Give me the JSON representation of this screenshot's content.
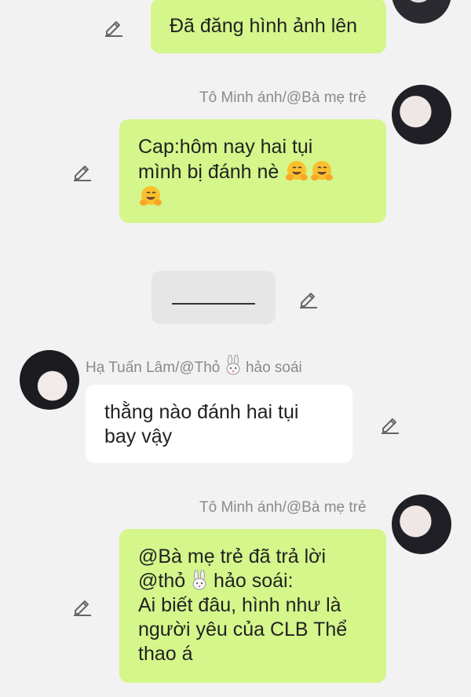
{
  "messages": [
    {
      "text": "Đã đăng hình ảnh lên"
    },
    {
      "sender": "Tô Minh ánh/@Bà mẹ trẻ",
      "text": "Cap:hôm nay hai tụi\nmình bị đánh nè",
      "emoji": "hugging-face"
    },
    {
      "text": ""
    },
    {
      "sender_prefix": "Hạ Tuấn Lâm/@Thỏ",
      "sender_suffix": "hảo soái",
      "text": "thằng nào đánh hai tụi\nbay vậy"
    },
    {
      "sender": "Tô Minh ánh/@Bà mẹ trẻ",
      "line1": "@Bà mẹ trẻ đã trả lời",
      "line2_prefix": "@thỏ",
      "line2_suffix": "hảo soái:",
      "body": "Ai biết đâu, hình như là\nngười yêu của CLB Thể\nthao á"
    }
  ],
  "colors": {
    "outgoing": "#d4f68b",
    "incoming": "#ffffff",
    "background": "#f2f2f2",
    "sender": "#8a8a8a"
  },
  "icons": [
    "pencil-edit-icon",
    "hugging-face-emoji",
    "rabbit-emoji"
  ]
}
